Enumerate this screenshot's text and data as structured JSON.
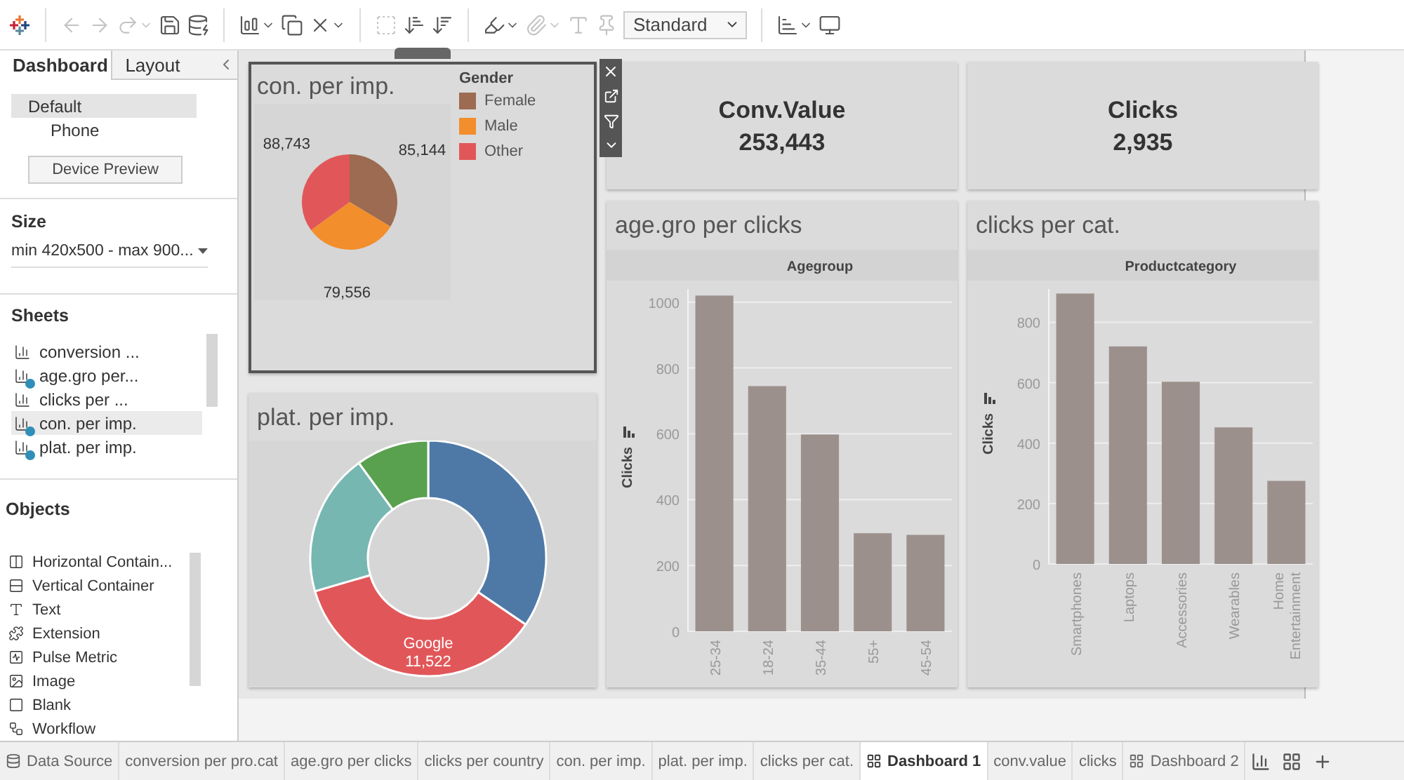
{
  "toolbar": {
    "view_size": "Standard"
  },
  "side_panel": {
    "tabs": [
      {
        "label": "Dashboard",
        "selected": true
      },
      {
        "label": "Layout",
        "selected": false
      }
    ],
    "devices": [
      {
        "label": "Default",
        "selected": true
      },
      {
        "label": "Phone",
        "selected": false
      }
    ],
    "device_preview_button": "Device Preview",
    "size": {
      "heading": "Size",
      "value": "min 420x500 - max 900..."
    },
    "sheets": {
      "heading": "Sheets",
      "items": [
        {
          "label": "conversion ...",
          "in_use": false,
          "selected": false
        },
        {
          "label": "age.gro per...",
          "in_use": true,
          "selected": false
        },
        {
          "label": "clicks per ...",
          "in_use": false,
          "selected": false
        },
        {
          "label": "con. per imp.",
          "in_use": true,
          "selected": true
        },
        {
          "label": "plat. per imp.",
          "in_use": true,
          "selected": false
        }
      ]
    },
    "objects": {
      "heading": "Objects",
      "items": [
        {
          "label": "Horizontal Contain...",
          "kind": "horizontal"
        },
        {
          "label": "Vertical Container",
          "kind": "vertical"
        },
        {
          "label": "Text",
          "kind": "text"
        },
        {
          "label": "Extension",
          "kind": "extension"
        },
        {
          "label": "Pulse Metric",
          "kind": "pulse"
        },
        {
          "label": "Image",
          "kind": "image"
        },
        {
          "label": "Blank",
          "kind": "blank"
        },
        {
          "label": "Workflow",
          "kind": "workflow"
        }
      ]
    }
  },
  "dashboard": {
    "con_per_imp": {
      "title": "con. per imp.",
      "selected": true,
      "legend": {
        "title": "Gender",
        "items": [
          {
            "label": "Female",
            "color": "#9c6b52"
          },
          {
            "label": "Male",
            "color": "#f28e2b"
          },
          {
            "label": "Other",
            "color": "#e15759"
          }
        ]
      },
      "chart_data": {
        "type": "pie",
        "values": [
          85144,
          79556,
          88743
        ],
        "value_labels": [
          "85,144",
          "79,556",
          "88,743"
        ]
      }
    },
    "plat_per_imp": {
      "title": "plat. per imp.",
      "slice_label": {
        "name": "Google",
        "value": "11,522"
      }
    },
    "kpis": [
      {
        "label": "Conv.Value",
        "value": "253,443"
      },
      {
        "label": "Clicks",
        "value": "2,935"
      }
    ],
    "bar_charts": [
      {
        "title": "age.gro per clicks",
        "chart_data": {
          "type": "bar",
          "title": "Agegroup",
          "ylabel": "Clicks",
          "categories": [
            "25-34",
            "18-24",
            "35-44",
            "55+",
            "45-54"
          ],
          "values": [
            1020,
            745,
            598,
            298,
            293
          ],
          "ylim": [
            0,
            1040
          ],
          "yticks": [
            0,
            200,
            400,
            600,
            800,
            1000
          ],
          "grid": true
        }
      },
      {
        "title": "clicks per cat.",
        "chart_data": {
          "type": "bar",
          "title": "Productcategory",
          "ylabel": "Clicks",
          "categories": [
            "Smartphones",
            "Laptops",
            "Accessories",
            "Wearables",
            "Home Entertainment"
          ],
          "values": [
            895,
            720,
            603,
            452,
            275
          ],
          "ylim": [
            0,
            910
          ],
          "yticks": [
            0,
            200,
            400,
            600,
            800
          ],
          "grid": true
        }
      }
    ]
  },
  "sheet_tabs": [
    {
      "label": "Data Source",
      "kind": "data_source",
      "selected": false
    },
    {
      "label": "conversion per pro.cat",
      "kind": "sheet",
      "selected": false
    },
    {
      "label": "age.gro per clicks",
      "kind": "sheet",
      "selected": false
    },
    {
      "label": "clicks per country",
      "kind": "sheet",
      "selected": false
    },
    {
      "label": "con. per imp.",
      "kind": "sheet",
      "selected": false
    },
    {
      "label": "plat. per imp.",
      "kind": "sheet",
      "selected": false
    },
    {
      "label": "clicks per cat.",
      "kind": "sheet",
      "selected": false
    },
    {
      "label": "Dashboard 1",
      "kind": "dashboard",
      "selected": true
    },
    {
      "label": "conv.value",
      "kind": "sheet",
      "selected": false
    },
    {
      "label": "clicks",
      "kind": "sheet",
      "selected": false
    },
    {
      "label": "Dashboard 2",
      "kind": "dashboard",
      "selected": false
    }
  ]
}
